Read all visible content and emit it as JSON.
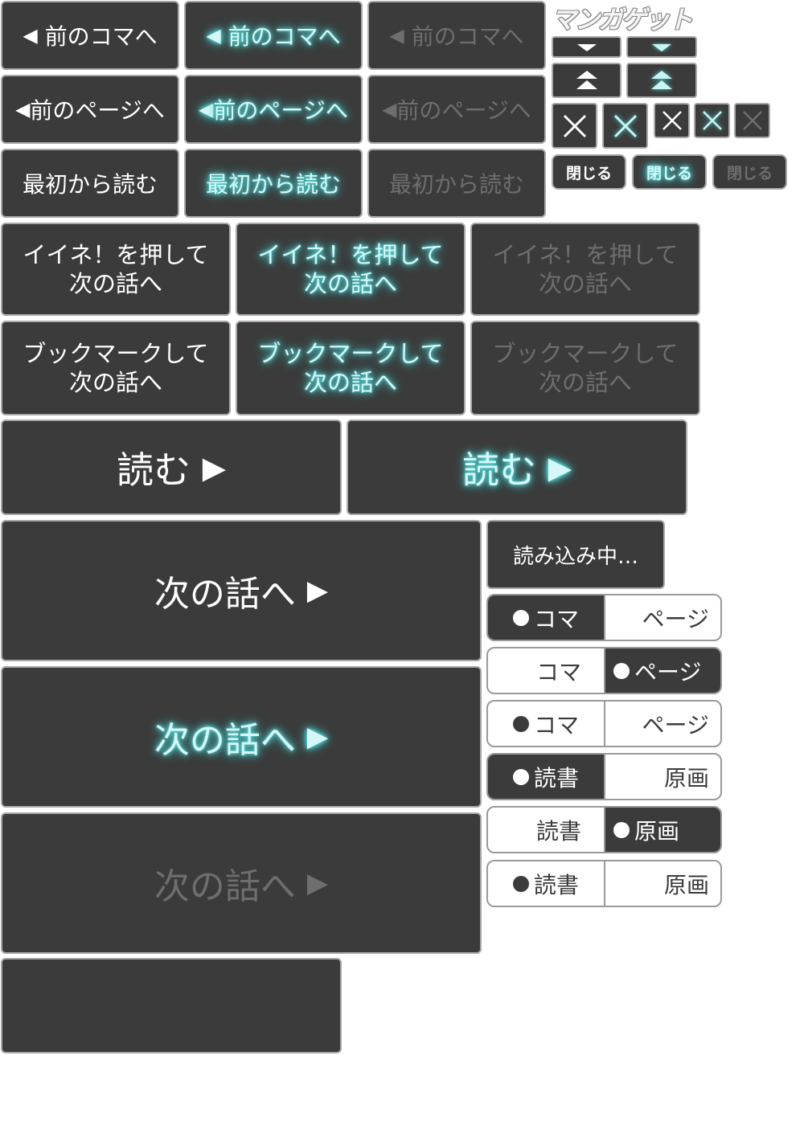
{
  "labels": {
    "prev_frame": "前のコマへ",
    "prev_page": "前のページへ",
    "from_start": "最初から読む",
    "like_next": "イイネ！を押して\n次の話へ",
    "bookmark_next": "ブックマークして\n次の話へ",
    "read": "読む",
    "next_episode": "次の話へ",
    "loading": "読み込み中…",
    "close": "閉じる"
  },
  "logo": {
    "text": "マンガゲット"
  },
  "toggles": [
    {
      "left": "コマ",
      "right": "ページ",
      "selected": "left",
      "style": "active"
    },
    {
      "left": "コマ",
      "right": "ページ",
      "selected": "right",
      "style": "active"
    },
    {
      "left": "コマ",
      "right": "ページ",
      "selected": "left",
      "style": "disabled"
    },
    {
      "left": "読書",
      "right": "原画",
      "selected": "left",
      "style": "active"
    },
    {
      "left": "読書",
      "right": "原画",
      "selected": "right",
      "style": "active"
    },
    {
      "left": "読書",
      "right": "原画",
      "selected": "left",
      "style": "disabled"
    }
  ],
  "toggle_text": {
    "t0_left": "コマ",
    "t0_right": "ページ",
    "t1_left": "コマ",
    "t1_right": "ページ",
    "t2_left": "コマ",
    "t2_right": "ページ",
    "t3_left": "読書",
    "t3_right": "原画",
    "t4_left": "読書",
    "t4_right": "原画",
    "t5_left": "読書",
    "t5_right": "原画"
  },
  "states": [
    "normal",
    "hover",
    "disabled"
  ],
  "colors": {
    "button_bg": "#3b3b3b",
    "border": "#a9a9a9",
    "glow": "#4fd3d3",
    "disabled_text": "#6e6e6e"
  },
  "icons": {
    "left": "triangle-left-icon",
    "right": "triangle-right-icon",
    "down": "chevron-down-icon",
    "top": "double-chevron-up-icon",
    "close": "close-x-icon"
  }
}
